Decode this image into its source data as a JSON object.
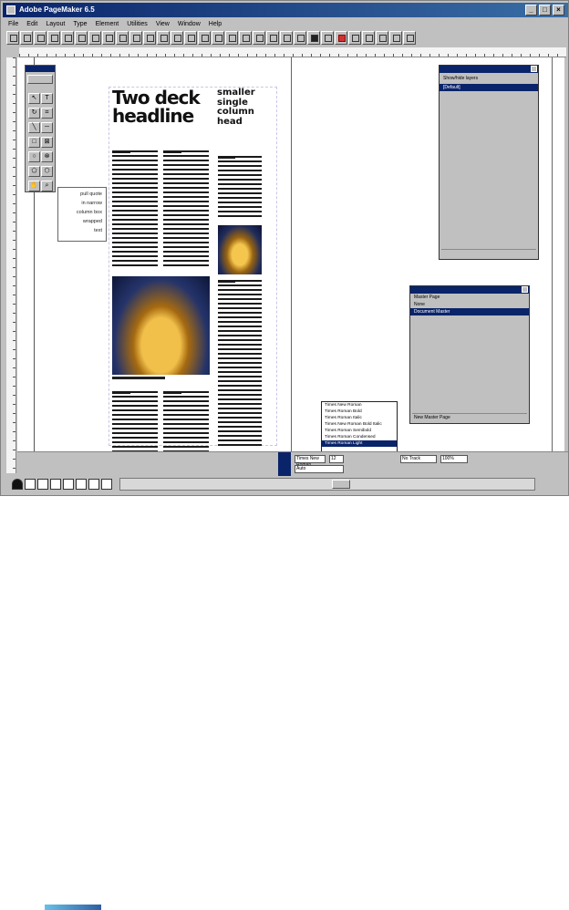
{
  "window": {
    "title": "Adobe PageMaker 6.5"
  },
  "menu": [
    "File",
    "Edit",
    "Layout",
    "Type",
    "Element",
    "Utilities",
    "View",
    "Window",
    "Help"
  ],
  "layout": {
    "headline": "Two deck headline",
    "single_column_head": "smaller single column head",
    "pullquote_lines": [
      "pull quote",
      "in narrow",
      "column box",
      "wrapped",
      "text"
    ]
  },
  "layers_palette": {
    "rows": [
      "Show/hide layers",
      "[Default]"
    ],
    "selected_index": 1
  },
  "master_pages_palette": {
    "rows": [
      "Master Page",
      "None",
      "Document Master"
    ],
    "selected_index": 2,
    "footer": "New Master Page"
  },
  "font_dropdown": {
    "items": [
      "Times New Roman",
      "Times Roman Bold",
      "Times Roman Italic",
      "Times New Roman Bold Italic",
      "Times Roman Semibold",
      "Times Roman Condensed",
      "Times Roman Light"
    ],
    "selected_index": 6
  },
  "status_bar": {
    "font_field": "Times New Roman",
    "size_field": "12",
    "leading_field": "Auto",
    "tracking_label": "No Track",
    "width_field": "100%"
  },
  "colors": {
    "titlebar": "#0a246a",
    "selection": "#0a246a",
    "photo_highlight": "#f1c04a"
  }
}
